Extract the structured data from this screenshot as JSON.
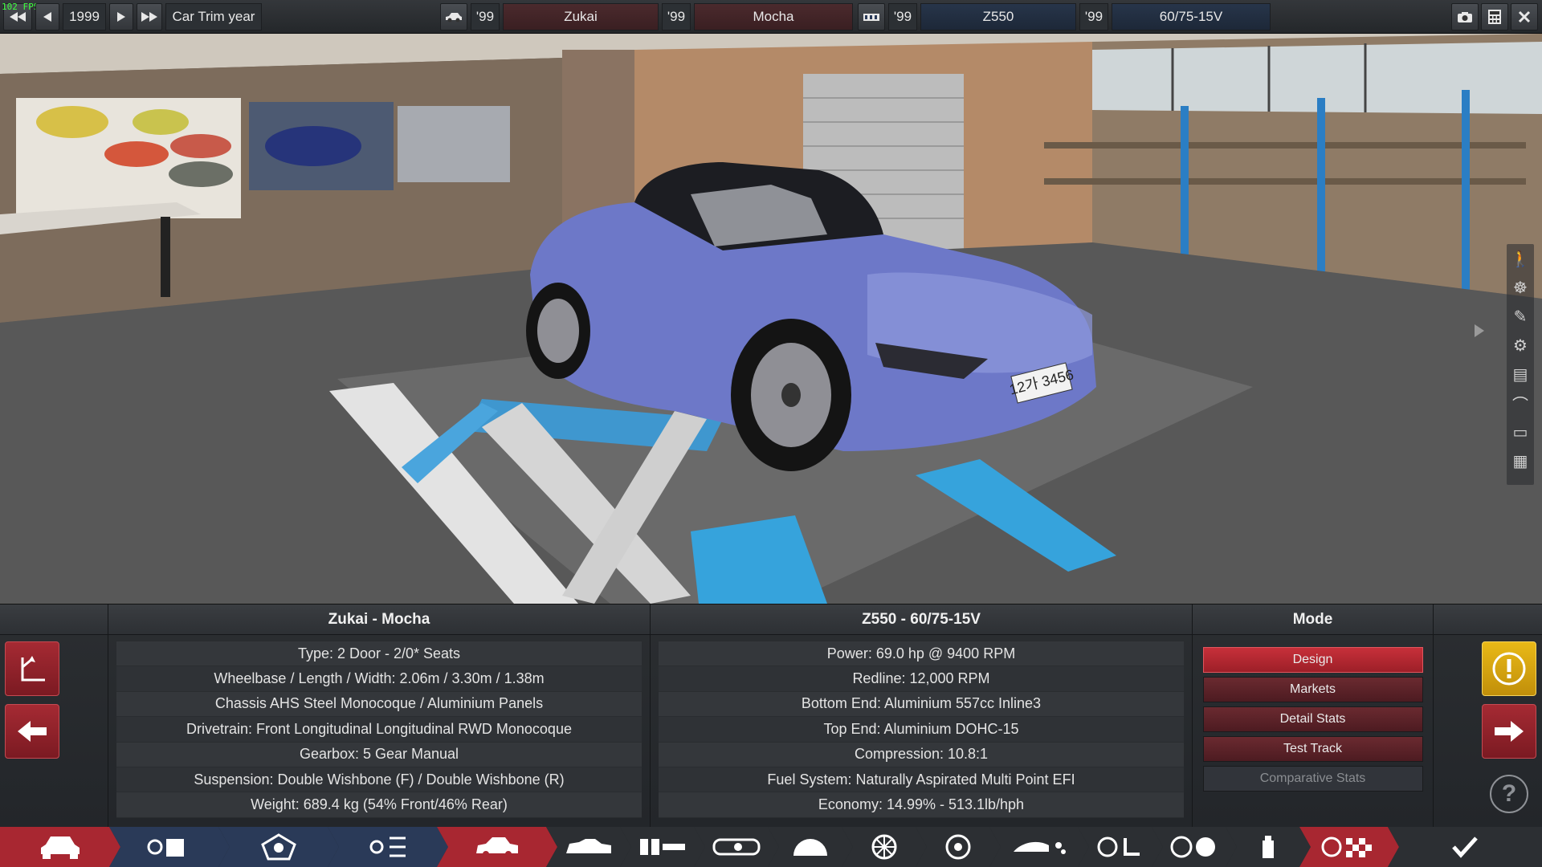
{
  "overlay": {
    "fps": "102 FPS"
  },
  "topbar": {
    "year": "1999",
    "year_label": "Car Trim year",
    "model_year": "'99",
    "model_name": "Zukai",
    "trim_year": "'99",
    "trim_name": "Mocha",
    "engine_year": "'99",
    "engine_name": "Z550",
    "variant_year": "'99",
    "variant_name": "60/75-15V"
  },
  "scene": {
    "license_plate": "12가 3456"
  },
  "car_panel": {
    "title": "Zukai - Mocha",
    "rows": [
      "Type: 2 Door - 2/0* Seats",
      "Wheelbase / Length / Width: 2.06m / 3.30m / 1.38m",
      "Chassis AHS Steel Monocoque / Aluminium Panels",
      "Drivetrain: Front Longitudinal Longitudinal RWD Monocoque",
      "Gearbox: 5 Gear Manual",
      "Suspension: Double Wishbone (F) / Double Wishbone (R)",
      "Weight: 689.4 kg (54% Front/46% Rear)"
    ]
  },
  "engine_panel": {
    "title": "Z550 - 60/75-15V",
    "rows": [
      "Power: 69.0 hp @ 9400 RPM",
      "Redline:  12,000 RPM",
      "Bottom End: Aluminium 557cc Inline3",
      "Top End: Aluminium DOHC-15",
      "Compression: 10.8:1",
      "Fuel System: Naturally Aspirated Multi Point EFI",
      "Economy: 14.99% - 513.1lb/hph"
    ]
  },
  "mode_panel": {
    "title": "Mode",
    "buttons": [
      "Design",
      "Markets",
      "Detail Stats",
      "Test Track",
      "Comparative Stats"
    ]
  },
  "help": {
    "label": "?"
  },
  "colors": {
    "accent_red": "#c7303a",
    "car_body": "#6d78c8",
    "lift_blue": "#2fa6dc",
    "warning_yellow": "#e9b917"
  }
}
